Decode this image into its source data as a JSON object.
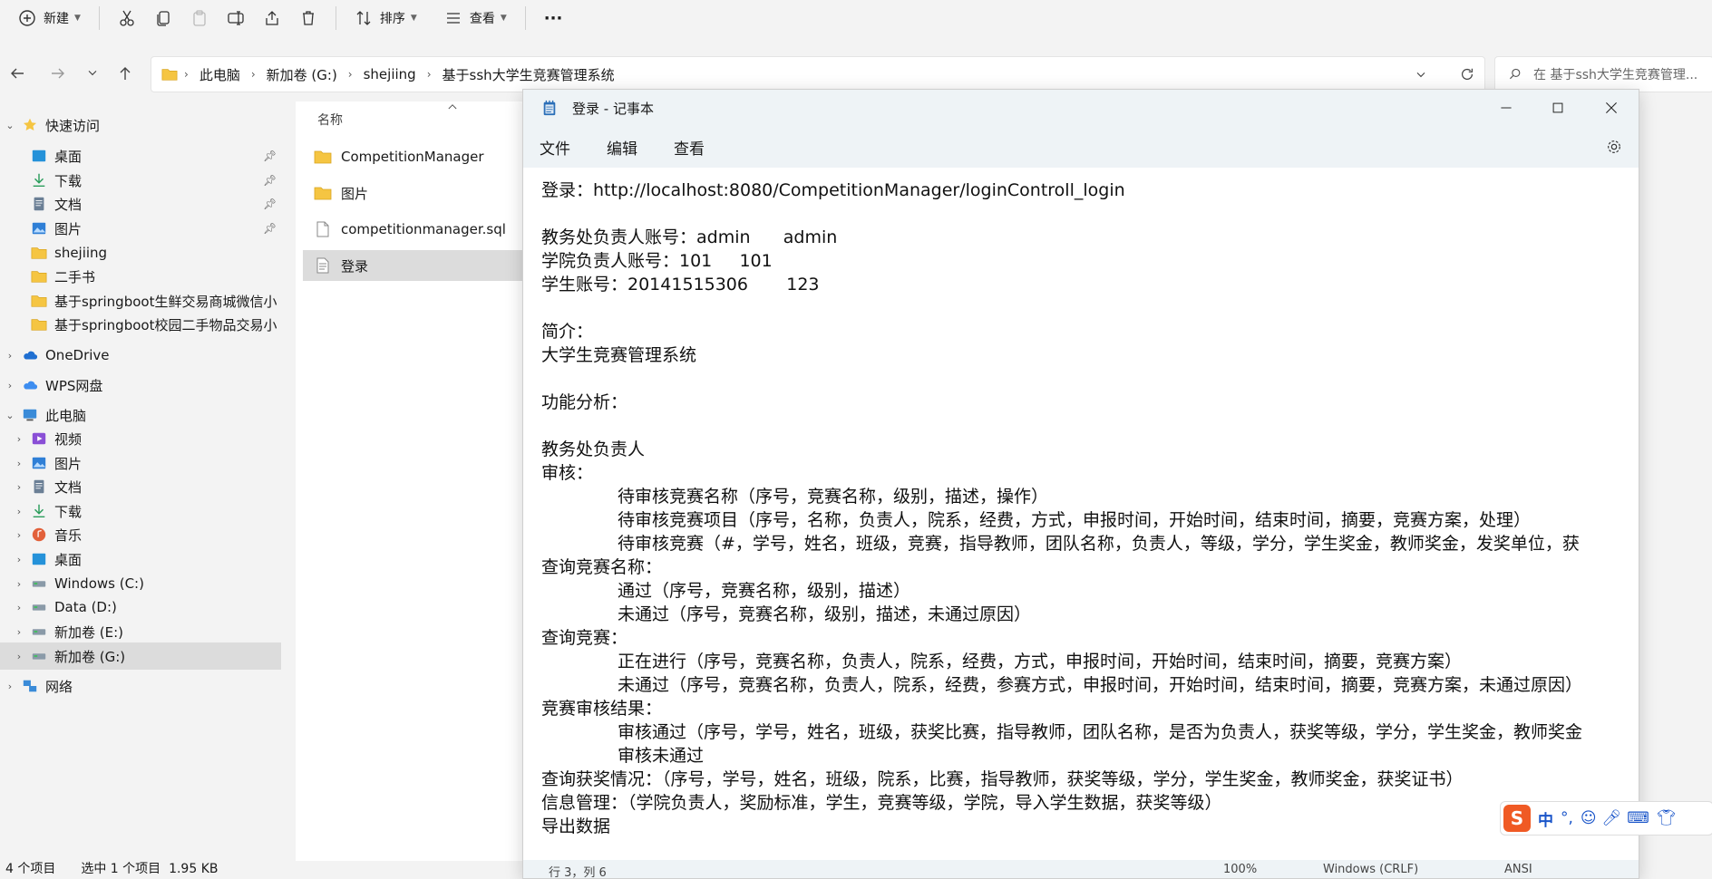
{
  "toolbar": {
    "new_label": "新建",
    "sort_label": "排序",
    "view_label": "查看",
    "more_label": "···"
  },
  "address": {
    "crumbs": [
      "此电脑",
      "新加卷 (G:)",
      "shejiing",
      "基于ssh大学生竞赛管理系统"
    ]
  },
  "search": {
    "placeholder": "在 基于ssh大学生竞赛管理..."
  },
  "sidebar": {
    "items": [
      {
        "label": "快速访问",
        "level": 0
      },
      {
        "label": "桌面",
        "level": 1,
        "pinned": true
      },
      {
        "label": "下载",
        "level": 1,
        "pinned": true
      },
      {
        "label": "文档",
        "level": 1,
        "pinned": true
      },
      {
        "label": "图片",
        "level": 1,
        "pinned": true
      },
      {
        "label": "shejiing",
        "level": 1
      },
      {
        "label": "二手书",
        "level": 1
      },
      {
        "label": "基于springboot生鲜交易商城微信小",
        "level": 1
      },
      {
        "label": "基于springboot校园二手物品交易小",
        "level": 1
      },
      {
        "label": "OneDrive",
        "level": 0
      },
      {
        "label": "WPS网盘",
        "level": 0
      },
      {
        "label": "此电脑",
        "level": 0
      },
      {
        "label": "视频",
        "level": 1
      },
      {
        "label": "图片",
        "level": 1
      },
      {
        "label": "文档",
        "level": 1
      },
      {
        "label": "下载",
        "level": 1
      },
      {
        "label": "音乐",
        "level": 1
      },
      {
        "label": "桌面",
        "level": 1
      },
      {
        "label": "Windows (C:)",
        "level": 1
      },
      {
        "label": "Data (D:)",
        "level": 1
      },
      {
        "label": "新加卷 (E:)",
        "level": 1
      },
      {
        "label": "新加卷 (G:)",
        "level": 1,
        "selected": true
      },
      {
        "label": "网络",
        "level": 0
      }
    ]
  },
  "filelist": {
    "column_name": "名称",
    "rows": [
      {
        "label": "CompetitionManager",
        "type": "folder"
      },
      {
        "label": "图片",
        "type": "folder"
      },
      {
        "label": "competitionmanager.sql",
        "type": "file"
      },
      {
        "label": "登录",
        "type": "text",
        "selected": true
      }
    ]
  },
  "statusbar": {
    "count": "4 个项目",
    "selection": "选中 1 个项目  1.95 KB"
  },
  "notepad": {
    "title": "登录 - 记事本",
    "menu": [
      "文件",
      "编辑",
      "查看"
    ],
    "lines": [
      {
        "text": "登录：http://localhost:8080/CompetitionManager/loginControll_login",
        "indent": false
      },
      {
        "text": "",
        "indent": false
      },
      {
        "text": "教务处负责人账号：admin      admin",
        "indent": false
      },
      {
        "text": "学院负责人账号：101     101",
        "indent": false
      },
      {
        "text": "学生账号：20141515306       123",
        "indent": false
      },
      {
        "text": "",
        "indent": false
      },
      {
        "text": "简介：",
        "indent": false
      },
      {
        "text": "大学生竞赛管理系统",
        "indent": false
      },
      {
        "text": "",
        "indent": false
      },
      {
        "text": "功能分析：",
        "indent": false
      },
      {
        "text": "",
        "indent": false
      },
      {
        "text": "教务处负责人",
        "indent": false
      },
      {
        "text": "审核：",
        "indent": false
      },
      {
        "text": "待审核竞赛名称（序号，竞赛名称，级别，描述，操作）",
        "indent": true
      },
      {
        "text": "待审核竞赛项目（序号，名称，负责人，院系，经费，方式，申报时间，开始时间，结束时间，摘要，竞赛方案，处理）",
        "indent": true
      },
      {
        "text": "待审核竞赛（#，学号，姓名，班级，竞赛，指导教师，团队名称，负责人，等级，学分，学生奖金，教师奖金，发奖单位，获",
        "indent": true
      },
      {
        "text": "查询竞赛名称：",
        "indent": false
      },
      {
        "text": "通过（序号，竞赛名称，级别，描述）",
        "indent": true
      },
      {
        "text": "未通过（序号，竞赛名称，级别，描述，未通过原因）",
        "indent": true
      },
      {
        "text": "查询竞赛：",
        "indent": false
      },
      {
        "text": "正在进行（序号，竞赛名称，负责人，院系，经费，方式，申报时间，开始时间，结束时间，摘要，竞赛方案）",
        "indent": true
      },
      {
        "text": "未通过（序号，竞赛名称，负责人，院系，经费，参赛方式，申报时间，开始时间，结束时间，摘要，竞赛方案，未通过原因）",
        "indent": true
      },
      {
        "text": "竞赛审核结果：",
        "indent": false
      },
      {
        "text": "审核通过（序号，学号，姓名，班级，获奖比赛，指导教师，团队名称，是否为负责人，获奖等级，学分，学生奖金，教师奖金",
        "indent": true
      },
      {
        "text": "审核未通过",
        "indent": true
      },
      {
        "text": "查询获奖情况：（序号，学号，姓名，班级，院系，比赛，指导教师，获奖等级，学分，学生奖金，教师奖金，获奖证书）",
        "indent": false
      },
      {
        "text": "信息管理：（学院负责人，奖励标准，学生，竞赛等级，学院，导入学生数据，获奖等级）",
        "indent": false
      },
      {
        "text": "导出数据",
        "indent": false
      }
    ],
    "status": {
      "position": "行 3，列 6",
      "zoom": "100%",
      "line_ending": "Windows (CRLF)",
      "encoding": "ANSI"
    }
  },
  "ime": {
    "label": "中"
  }
}
